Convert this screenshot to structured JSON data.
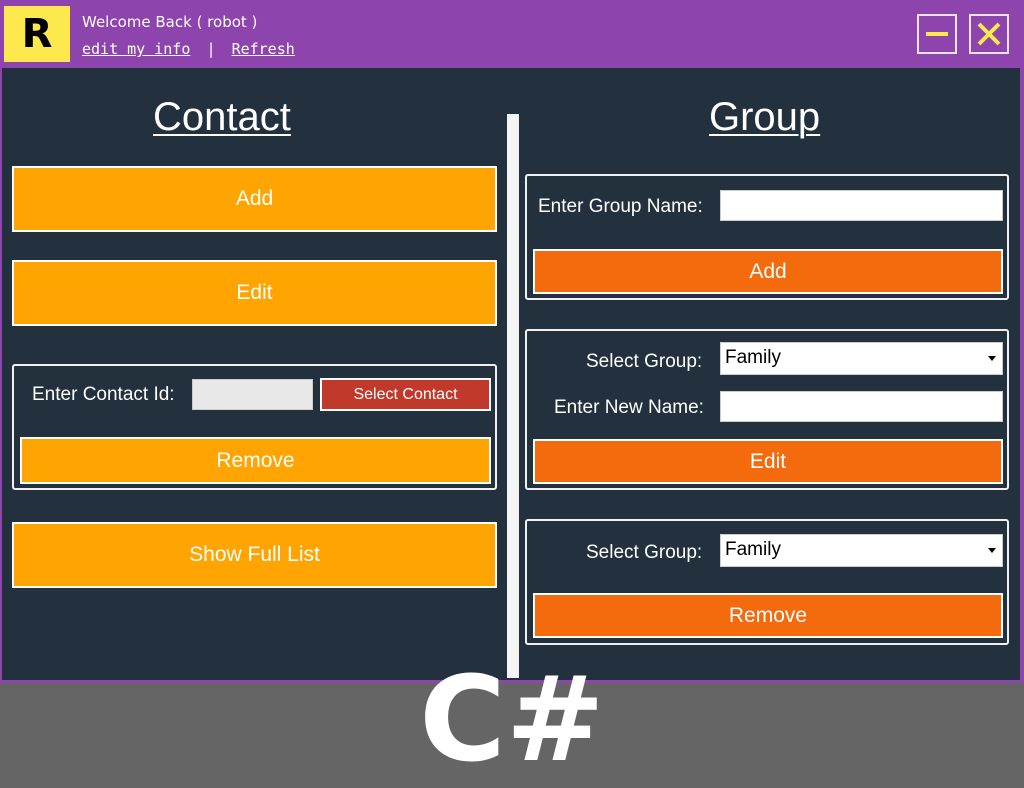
{
  "titlebar": {
    "logo_letter": "R",
    "welcome_text": "Welcome Back ( robot )",
    "edit_info_link": "edit my info",
    "separator": "|",
    "refresh_link": "Refresh",
    "minimize_icon": "minimize-icon",
    "close_icon": "close-icon"
  },
  "contact": {
    "title": "Contact",
    "add_label": "Add",
    "edit_label": "Edit",
    "contact_id_label": "Enter Contact Id:",
    "contact_id_value": "",
    "select_contact_label": "Select Contact",
    "remove_label": "Remove",
    "show_full_list_label": "Show Full List"
  },
  "group": {
    "title": "Group",
    "add_panel": {
      "name_label": "Enter Group Name:",
      "name_value": "",
      "add_label": "Add"
    },
    "edit_panel": {
      "select_label": "Select Group:",
      "selected_value": "Family",
      "new_name_label": "Enter New Name:",
      "new_name_value": "",
      "edit_label": "Edit"
    },
    "remove_panel": {
      "select_label": "Select Group:",
      "selected_value": "Family",
      "remove_label": "Remove"
    }
  },
  "watermark": "C#",
  "colors": {
    "titlebar": "#8e44ad",
    "content_bg": "#23313f",
    "contact_button": "#ffa400",
    "group_button": "#f36b0d",
    "select_contact_button": "#c0392b",
    "logo_bg": "#fde84e",
    "window_button_icon": "#fde84e"
  }
}
